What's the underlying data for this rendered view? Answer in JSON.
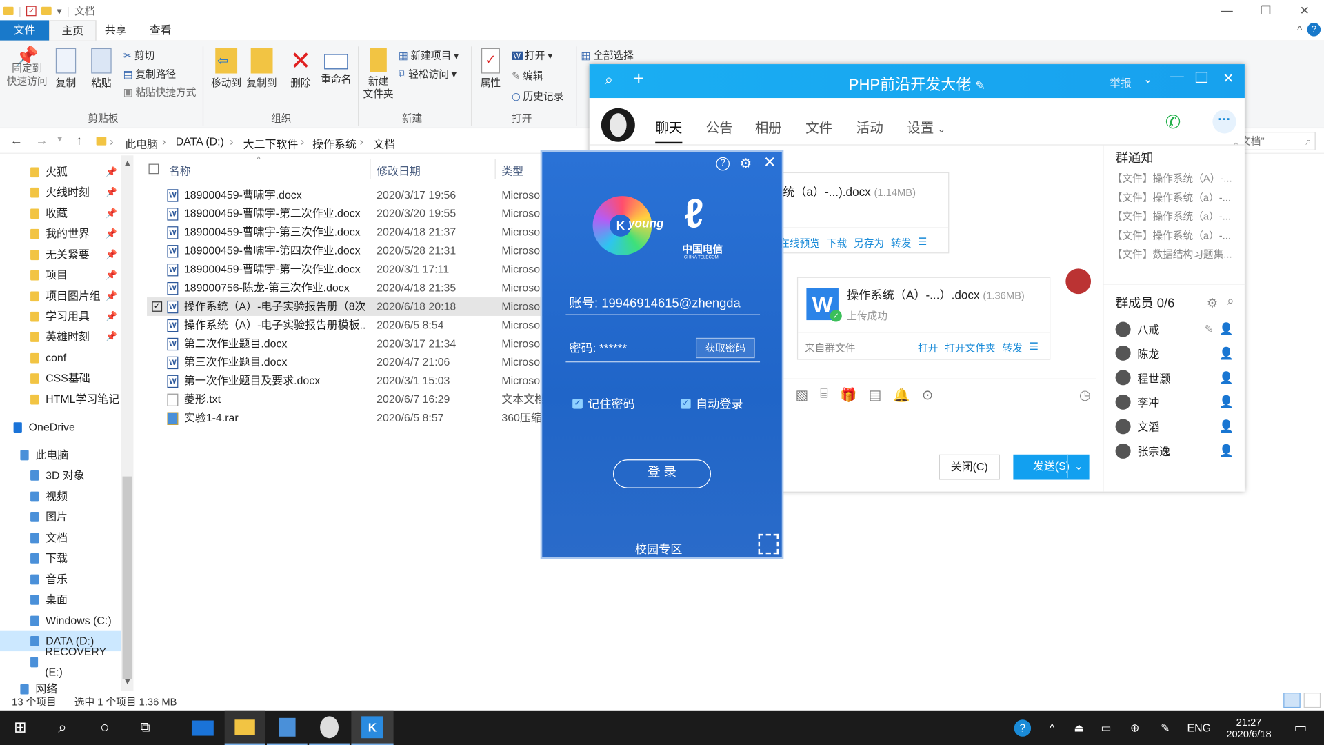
{
  "explorer": {
    "title": "文档",
    "tabs": {
      "file": "文件",
      "home": "主页",
      "share": "共享",
      "view": "查看"
    },
    "ribbon": {
      "pin": "固定到\n快速访问",
      "copy": "复制",
      "paste": "粘贴",
      "cut": "剪切",
      "copy_path": "复制路径",
      "paste_shortcut": "粘贴快捷方式",
      "group_clipboard": "剪贴板",
      "move_to": "移动到",
      "copy_to": "复制到",
      "delete": "删除",
      "rename": "重命名",
      "group_organize": "组织",
      "new_folder": "新建\n文件夹",
      "new_item": "新建项目",
      "easy_access": "轻松访问",
      "group_new": "新建",
      "properties": "属性",
      "open": "打开",
      "edit": "编辑",
      "history": "历史记录",
      "group_open": "打开",
      "select_all": "全部选择"
    },
    "breadcrumb": [
      "此电脑",
      "DATA (D:)",
      "大二下软件",
      "操作系统",
      "文档"
    ],
    "search_placeholder": "索\"文档\"",
    "nav": [
      {
        "label": "火狐",
        "pin": true
      },
      {
        "label": "火线时刻",
        "pin": true
      },
      {
        "label": "收藏",
        "pin": true
      },
      {
        "label": "我的世界",
        "pin": true
      },
      {
        "label": "无关紧要",
        "pin": true
      },
      {
        "label": "项目",
        "pin": true
      },
      {
        "label": "项目图片组",
        "pin": true
      },
      {
        "label": "学习用具",
        "pin": true
      },
      {
        "label": "英雄时刻",
        "pin": true
      },
      {
        "label": "conf",
        "pin": false
      },
      {
        "label": "CSS基础",
        "pin": false
      },
      {
        "label": "HTML学习笔记",
        "pin": false
      },
      {
        "label": "OneDrive"
      },
      {
        "label": "此电脑"
      },
      {
        "label": "3D 对象"
      },
      {
        "label": "视频"
      },
      {
        "label": "图片"
      },
      {
        "label": "文档"
      },
      {
        "label": "下载"
      },
      {
        "label": "音乐"
      },
      {
        "label": "桌面"
      },
      {
        "label": "Windows (C:)"
      },
      {
        "label": "DATA (D:)"
      },
      {
        "label": "RECOVERY (E:)"
      },
      {
        "label": "网络"
      }
    ],
    "columns": {
      "name": "名称",
      "date": "修改日期",
      "type": "类型"
    },
    "files": [
      {
        "name": "189000459-曹啸宇.docx",
        "date": "2020/3/17 19:56",
        "type": "Microso"
      },
      {
        "name": "189000459-曹啸宇-第二次作业.docx",
        "date": "2020/3/20 19:55",
        "type": "Microso"
      },
      {
        "name": "189000459-曹啸宇-第三次作业.docx",
        "date": "2020/4/18 21:37",
        "type": "Microso"
      },
      {
        "name": "189000459-曹啸宇-第四次作业.docx",
        "date": "2020/5/28 21:31",
        "type": "Microso"
      },
      {
        "name": "189000459-曹啸宇-第一次作业.docx",
        "date": "2020/3/1 17:11",
        "type": "Microso"
      },
      {
        "name": "189000756-陈龙-第三次作业.docx",
        "date": "2020/4/18 21:35",
        "type": "Microso"
      },
      {
        "name": "操作系统（A）-电子实验报告册（8次...",
        "date": "2020/6/18 20:18",
        "type": "Microso"
      },
      {
        "name": "操作系统（A）-电子实验报告册模板....",
        "date": "2020/6/5 8:54",
        "type": "Microso"
      },
      {
        "name": "第二次作业题目.docx",
        "date": "2020/3/17 21:34",
        "type": "Microso"
      },
      {
        "name": "第三次作业题目.docx",
        "date": "2020/4/7 21:06",
        "type": "Microso"
      },
      {
        "name": "第一次作业题目及要求.docx",
        "date": "2020/3/1 15:03",
        "type": "Microso"
      },
      {
        "name": "菱形.txt",
        "date": "2020/6/7 16:29",
        "type": "文本文档"
      },
      {
        "name": "实验1-4.rar",
        "date": "2020/6/5 8:57",
        "type": "360压缩"
      }
    ],
    "status_count": "13 个项目",
    "status_selected": "选中 1 个项目  1.36 MB"
  },
  "qq": {
    "title": "PHP前沿开发大佬",
    "report": "举报",
    "tabs": [
      "聊天",
      "公告",
      "相册",
      "文件",
      "活动",
      "设置"
    ],
    "file1": {
      "name": "统（a）-...).docx",
      "size": "(1.14MB)",
      "actions": [
        "在线预览",
        "下载",
        "另存为",
        "转发"
      ]
    },
    "file2": {
      "name": "操作系统（A）-...）.docx",
      "size": "(1.36MB)",
      "status": "上传成功",
      "from": "来自群文件",
      "actions": [
        "打开",
        "打开文件夹",
        "转发"
      ]
    },
    "close_btn": "关闭(C)",
    "send_btn": "发送(S)",
    "notice_title": "群通知",
    "notices": [
      "【文件】操作系统（A）-...",
      "【文件】操作系统（a）-...",
      "【文件】操作系统（a）-...",
      "【文件】操作系统（a）-...",
      "【文件】数据结构习题集..."
    ],
    "members_title": "群成员 0/6",
    "members": [
      "八戒",
      "陈龙",
      "程世灏",
      "李冲",
      "文滔",
      "张宗逸"
    ]
  },
  "telecom": {
    "account_label": "账号: 19946914615@zhengda",
    "password_label": "密码: ******",
    "get_password": "获取密码",
    "remember": "记住密码",
    "autologin": "自动登录",
    "login": "登  录",
    "campus": "校园专区",
    "logo_young": "young",
    "logo_cn": "中国电信",
    "logo_en": "CHINA TELECOM"
  },
  "taskbar": {
    "lang": "ENG",
    "time": "21:27",
    "date": "2020/6/18"
  }
}
